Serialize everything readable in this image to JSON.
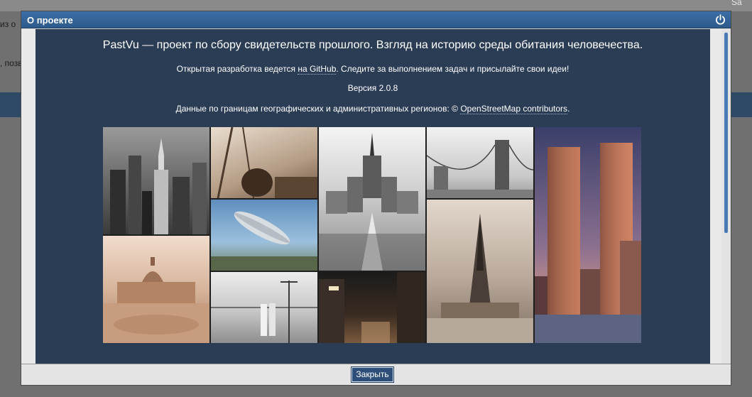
{
  "background": {
    "fragment_top_left": "из о",
    "fragment_left": ", позв",
    "fragment_top_right": "Sa"
  },
  "dialog": {
    "title": "О проекте",
    "headline": "PastVu — проект по сбору свидетельств прошлого. Взгляд на историю среды обитания человечества.",
    "dev_prefix": "Открытая разработка ведется ",
    "dev_link": "на GitHub",
    "dev_suffix": ". Следите за выполнением задач и присылайте свои идеи!",
    "version": "Версия 2.0.8",
    "osm_prefix": "Данные по границам географических и административных регионов: © ",
    "osm_link": "OpenStreetMap contributors",
    "osm_suffix": ".",
    "close_label": "Закрыть"
  },
  "icons": {
    "power": "power-icon"
  },
  "colors": {
    "header": "#2d5a8c",
    "content_bg": "#2b3c55",
    "button": "#2d4e78",
    "text": "#ffffff"
  }
}
